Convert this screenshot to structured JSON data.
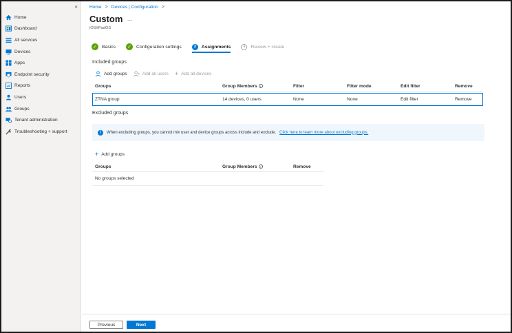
{
  "sidebar": {
    "collapse_glyph": "«",
    "items": [
      {
        "label": "Home",
        "icon": "home-icon"
      },
      {
        "label": "Dashboard",
        "icon": "dashboard-icon"
      },
      {
        "label": "All services",
        "icon": "all-services-icon"
      },
      {
        "label": "Devices",
        "icon": "devices-icon"
      },
      {
        "label": "Apps",
        "icon": "apps-icon"
      },
      {
        "label": "Endpoint security",
        "icon": "endpoint-security-icon"
      },
      {
        "label": "Reports",
        "icon": "reports-icon"
      },
      {
        "label": "Users",
        "icon": "users-icon"
      },
      {
        "label": "Groups",
        "icon": "groups-icon"
      },
      {
        "label": "Tenant administration",
        "icon": "tenant-administration-icon"
      },
      {
        "label": "Troubleshooting + support",
        "icon": "troubleshooting-icon"
      }
    ]
  },
  "breadcrumb": {
    "home": "Home",
    "sep": ">",
    "section": "Devices | Configuration"
  },
  "header": {
    "title": "Custom",
    "more": "...",
    "subtitle": "iOS/iPadOS"
  },
  "steps": [
    {
      "label": "Basics",
      "state": "done",
      "marker": "✓"
    },
    {
      "label": "Configuration settings",
      "state": "done",
      "marker": "✓"
    },
    {
      "label": "Assignments",
      "state": "active",
      "marker": "3"
    },
    {
      "label": "Review + create",
      "state": "disabled",
      "marker": "4"
    }
  ],
  "included": {
    "title": "Included groups",
    "actions": {
      "add_groups": "Add groups",
      "add_all_users": "Add all users",
      "add_all_devices": "Add all devices"
    },
    "columns": {
      "groups": "Groups",
      "members": "Group Members",
      "filter": "Filter",
      "filter_mode": "Filter mode",
      "edit_filter": "Edit filter",
      "remove": "Remove"
    },
    "rows": [
      {
        "group": "ZTNA group",
        "members": "14 devices, 0 users",
        "filter": "None",
        "filter_mode": "None",
        "edit_filter": "Edit filter",
        "remove": "Remove"
      }
    ]
  },
  "excluded": {
    "title": "Excluded groups",
    "banner_text": "When excluding groups, you cannot mix user and device groups across include and exclude.",
    "banner_link": "Click here to learn more about excluding groups.",
    "add_groups": "Add groups",
    "columns": {
      "groups": "Groups",
      "members": "Group Members",
      "remove": "Remove"
    },
    "empty": "No groups selected"
  },
  "footer": {
    "previous": "Previous",
    "next": "Next"
  },
  "colors": {
    "accent": "#0078d4",
    "success": "#57a300",
    "sidebar_bg": "#f3f2f1",
    "banner_bg": "#eff6fc"
  }
}
